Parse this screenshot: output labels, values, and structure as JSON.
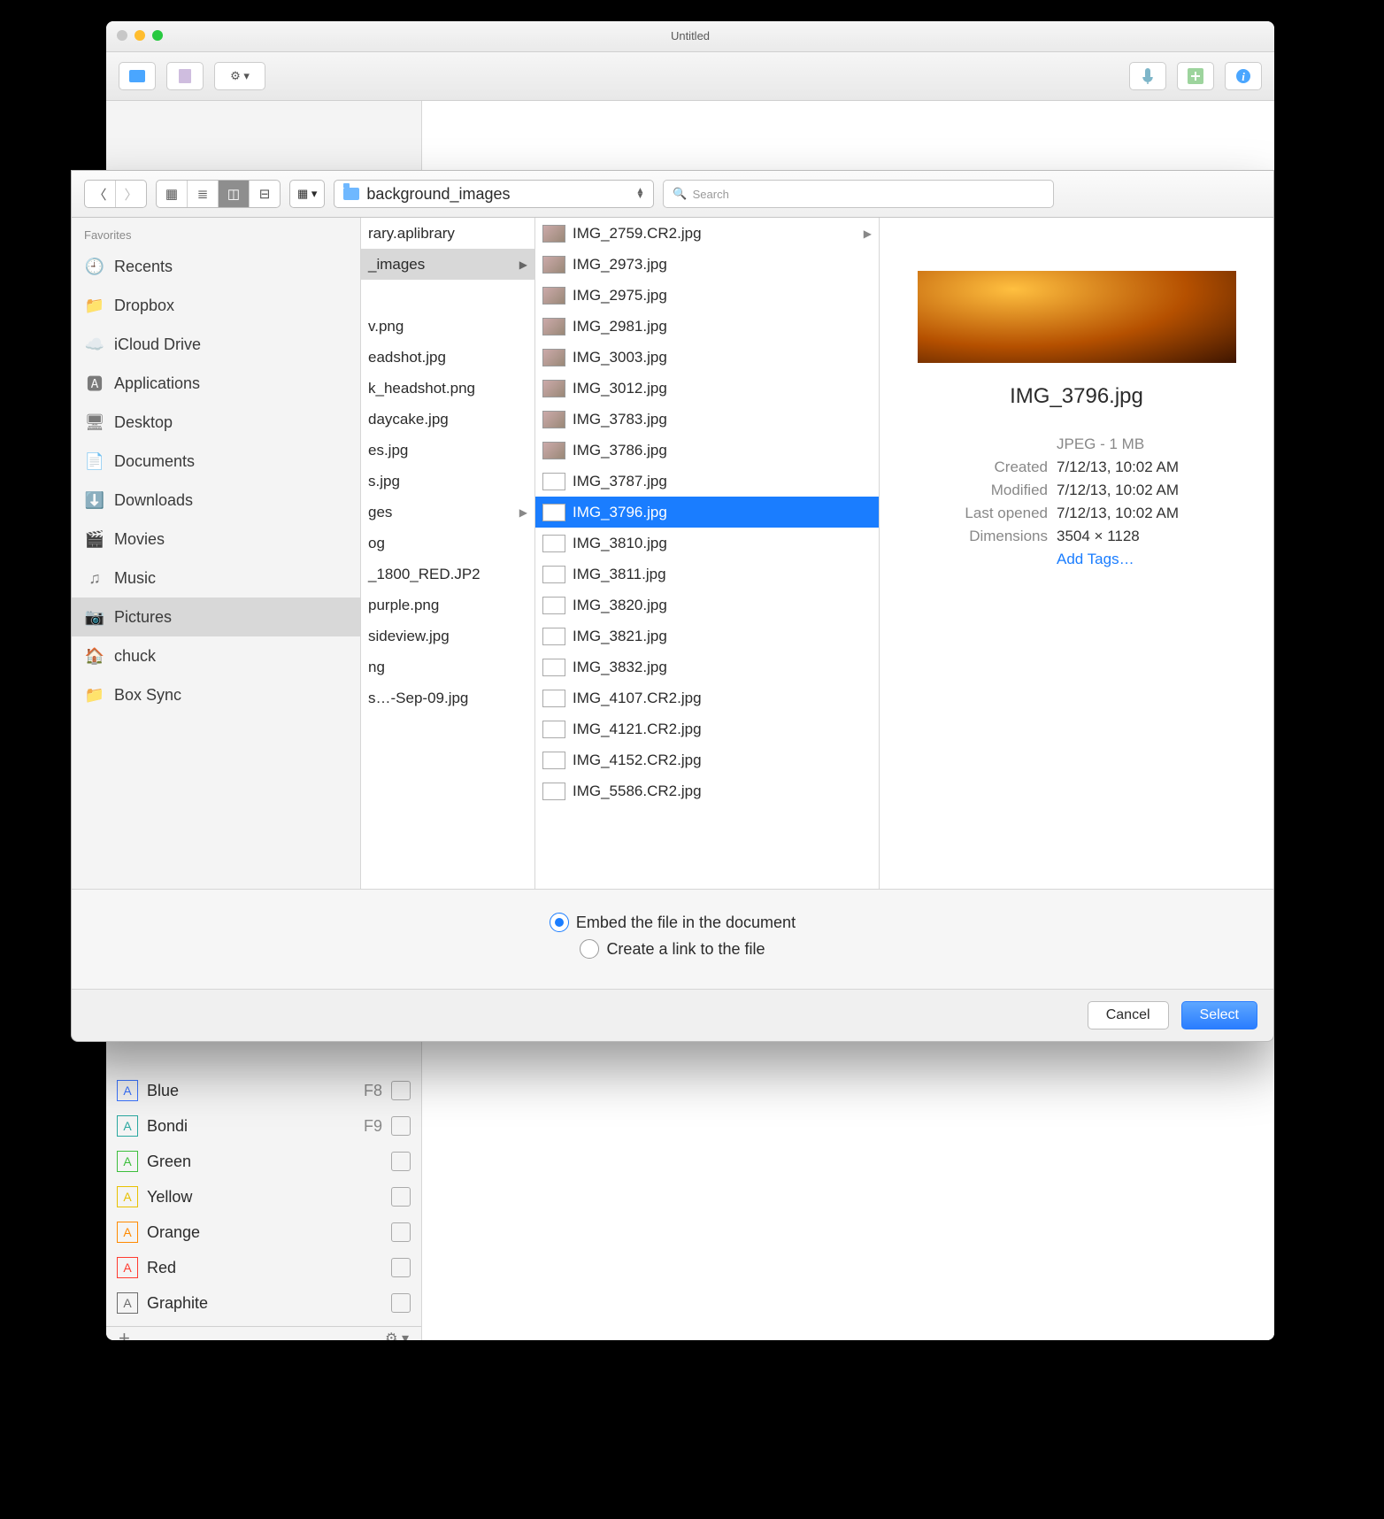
{
  "main_window": {
    "title": "Untitled"
  },
  "inspector": {
    "colors": [
      {
        "name": "Blue",
        "shortcut": "F8",
        "hex": "#3b74ff"
      },
      {
        "name": "Bondi",
        "shortcut": "F9",
        "hex": "#2aa8a0"
      },
      {
        "name": "Green",
        "shortcut": "",
        "hex": "#3dbf3d"
      },
      {
        "name": "Yellow",
        "shortcut": "",
        "hex": "#e8c100"
      },
      {
        "name": "Orange",
        "shortcut": "",
        "hex": "#ff8a00"
      },
      {
        "name": "Red",
        "shortcut": "",
        "hex": "#ff3b30"
      },
      {
        "name": "Graphite",
        "shortcut": "",
        "hex": "#6b6b6b"
      }
    ]
  },
  "dialog": {
    "location_label": "background_images",
    "search_placeholder": "Search",
    "sidebar_header": "Favorites",
    "favorites": [
      {
        "name": "Recents",
        "icon": "recent"
      },
      {
        "name": "Dropbox",
        "icon": "folder"
      },
      {
        "name": "iCloud Drive",
        "icon": "cloud"
      },
      {
        "name": "Applications",
        "icon": "apps"
      },
      {
        "name": "Desktop",
        "icon": "desktop"
      },
      {
        "name": "Documents",
        "icon": "documents"
      },
      {
        "name": "Downloads",
        "icon": "downloads"
      },
      {
        "name": "Movies",
        "icon": "movies"
      },
      {
        "name": "Music",
        "icon": "music"
      },
      {
        "name": "Pictures",
        "icon": "pictures",
        "selected": true
      },
      {
        "name": "chuck",
        "icon": "home"
      },
      {
        "name": "Box Sync",
        "icon": "folder"
      }
    ],
    "col1": [
      {
        "name": "rary.aplibrary",
        "arrow": false
      },
      {
        "name": "_images",
        "arrow": true,
        "selected": true
      },
      {
        "name": "",
        "spacer": true
      },
      {
        "name": "v.png"
      },
      {
        "name": "eadshot.jpg"
      },
      {
        "name": "k_headshot.png"
      },
      {
        "name": "daycake.jpg"
      },
      {
        "name": "es.jpg"
      },
      {
        "name": "s.jpg"
      },
      {
        "name": "ges",
        "arrow": true
      },
      {
        "name": "og"
      },
      {
        "name": "_1800_RED.JP2"
      },
      {
        "name": "purple.png"
      },
      {
        "name": "sideview.jpg"
      },
      {
        "name": "ng"
      },
      {
        "name": "s…-Sep-09.jpg"
      }
    ],
    "col2": [
      {
        "name": "IMG_2759.CR2.jpg",
        "arrow": true
      },
      {
        "name": "IMG_2973.jpg"
      },
      {
        "name": "IMG_2975.jpg"
      },
      {
        "name": "IMG_2981.jpg"
      },
      {
        "name": "IMG_3003.jpg"
      },
      {
        "name": "IMG_3012.jpg"
      },
      {
        "name": "IMG_3783.jpg"
      },
      {
        "name": "IMG_3786.jpg"
      },
      {
        "name": "IMG_3787.jpg"
      },
      {
        "name": "IMG_3796.jpg",
        "selected": true
      },
      {
        "name": "IMG_3810.jpg"
      },
      {
        "name": "IMG_3811.jpg"
      },
      {
        "name": "IMG_3820.jpg"
      },
      {
        "name": "IMG_3821.jpg"
      },
      {
        "name": "IMG_3832.jpg"
      },
      {
        "name": "IMG_4107.CR2.jpg"
      },
      {
        "name": "IMG_4121.CR2.jpg"
      },
      {
        "name": "IMG_4152.CR2.jpg"
      },
      {
        "name": "IMG_5586.CR2.jpg"
      }
    ],
    "preview": {
      "filename": "IMG_3796.jpg",
      "kind": "JPEG - 1 MB",
      "meta": [
        {
          "label": "Created",
          "value": "7/12/13, 10:02 AM"
        },
        {
          "label": "Modified",
          "value": "7/12/13, 10:02 AM"
        },
        {
          "label": "Last opened",
          "value": "7/12/13, 10:02 AM"
        },
        {
          "label": "Dimensions",
          "value": "3504 × 1128"
        }
      ],
      "tags_label": "Add Tags…"
    },
    "options": {
      "embed": "Embed the file in the document",
      "link": "Create a link to the file"
    },
    "cancel": "Cancel",
    "select": "Select"
  }
}
